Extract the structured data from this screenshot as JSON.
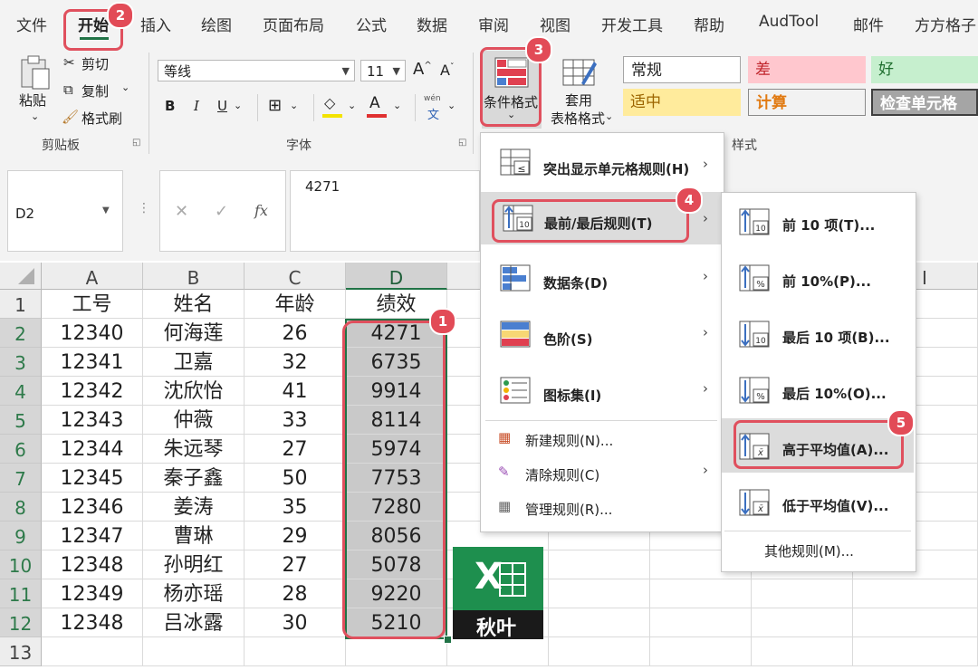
{
  "tabs": [
    "文件",
    "开始",
    "插入",
    "绘图",
    "页面布局",
    "公式",
    "数据",
    "审阅",
    "视图",
    "开发工具",
    "帮助",
    "AudTool",
    "邮件",
    "方方格子"
  ],
  "clipboard": {
    "paste": "粘贴",
    "cut": "剪切",
    "copy": "复制",
    "format_painter": "格式刷",
    "group_label": "剪贴板"
  },
  "font": {
    "name": "等线",
    "size": "11",
    "group_label": "字体",
    "bold": "B",
    "italic": "I",
    "underline": "U",
    "phonetic_top": "wén",
    "phonetic_bottom": "文"
  },
  "conditional_format": {
    "line1": "条件格式",
    "apply_table_line1": "套用",
    "apply_table_line2": "表格格式"
  },
  "styles": {
    "group_label": "样式",
    "normal": "常规",
    "bad": "差",
    "good": "好",
    "neutral": "适中",
    "calculation": "计算",
    "check_cell": "检查单元格"
  },
  "formula_bar": {
    "name_box": "D2",
    "fx": "fx",
    "value": "4271"
  },
  "columns": [
    "A",
    "B",
    "C",
    "D",
    "I"
  ],
  "rows": [
    "1",
    "2",
    "3",
    "4",
    "5",
    "6",
    "7",
    "8",
    "9",
    "10",
    "11",
    "12",
    "13"
  ],
  "table": {
    "header": [
      "工号",
      "姓名",
      "年龄",
      "绩效"
    ],
    "data": [
      [
        "12340",
        "何海莲",
        "26",
        "4271"
      ],
      [
        "12341",
        "卫嘉",
        "32",
        "6735"
      ],
      [
        "12342",
        "沈欣怡",
        "41",
        "9914"
      ],
      [
        "12343",
        "仲薇",
        "33",
        "8114"
      ],
      [
        "12344",
        "朱远琴",
        "27",
        "5974"
      ],
      [
        "12345",
        "秦子鑫",
        "50",
        "7753"
      ],
      [
        "12346",
        "姜涛",
        "35",
        "7280"
      ],
      [
        "12347",
        "曹琳",
        "29",
        "8056"
      ],
      [
        "12348",
        "孙明红",
        "27",
        "5078"
      ],
      [
        "12349",
        "杨亦瑶",
        "28",
        "9220"
      ],
      [
        "12348",
        "吕冰露",
        "30",
        "5210"
      ]
    ]
  },
  "cf_menu": [
    "突出显示单元格规则(H)",
    "最前/最后规则(T)",
    "数据条(D)",
    "色阶(S)",
    "图标集(I)",
    "新建规则(N)...",
    "清除规则(C)",
    "管理规则(R)..."
  ],
  "submenu": [
    "前 10 项(T)...",
    "前 10%(P)...",
    "最后 10 项(B)...",
    "最后 10%(O)...",
    "高于平均值(A)...",
    "低于平均值(V)...",
    "其他规则(M)..."
  ],
  "icon_labels": {
    "ten": "10",
    "pct": "%",
    "xbar": "x̄"
  },
  "badges": [
    "1",
    "2",
    "3",
    "4",
    "5"
  ],
  "logo": {
    "x": "X",
    "text": "秋叶"
  }
}
